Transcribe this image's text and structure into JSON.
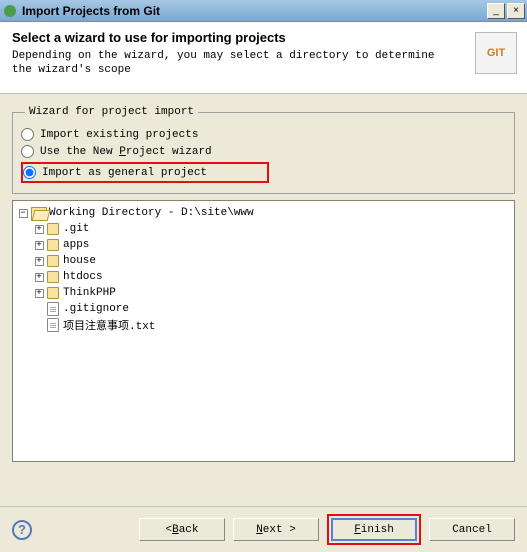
{
  "titlebar": {
    "text": "Import Projects from Git"
  },
  "header": {
    "title": "Select a wizard to use for importing projects",
    "desc": "Depending on the wizard, you may select a directory to determine the wizard's scope",
    "logo": "GIT"
  },
  "wizard_group": {
    "legend": "Wizard for project import",
    "options": {
      "existing": "Import existing projects",
      "new_prefix": "Use the New ",
      "new_u": "P",
      "new_suffix": "roject wizard",
      "general": "Import as general project"
    },
    "selected": "general"
  },
  "tree": {
    "root_expander": "−",
    "root_label": "Working Directory - D:\\site\\www",
    "children": [
      {
        "type": "folder",
        "exp": "+",
        "label": ".git"
      },
      {
        "type": "folder",
        "exp": "+",
        "label": "apps"
      },
      {
        "type": "folder",
        "exp": "+",
        "label": "house"
      },
      {
        "type": "folder",
        "exp": "+",
        "label": "htdocs"
      },
      {
        "type": "folder",
        "exp": "+",
        "label": "ThinkPHP"
      },
      {
        "type": "file",
        "label": ".gitignore"
      },
      {
        "type": "file",
        "label": "项目注意事项.txt"
      }
    ]
  },
  "buttons": {
    "back_prefix": "< ",
    "back_u": "B",
    "back_suffix": "ack",
    "next_u": "N",
    "next_suffix": "ext >",
    "finish_u": "F",
    "finish_suffix": "inish",
    "cancel": "Cancel"
  },
  "help": "?"
}
